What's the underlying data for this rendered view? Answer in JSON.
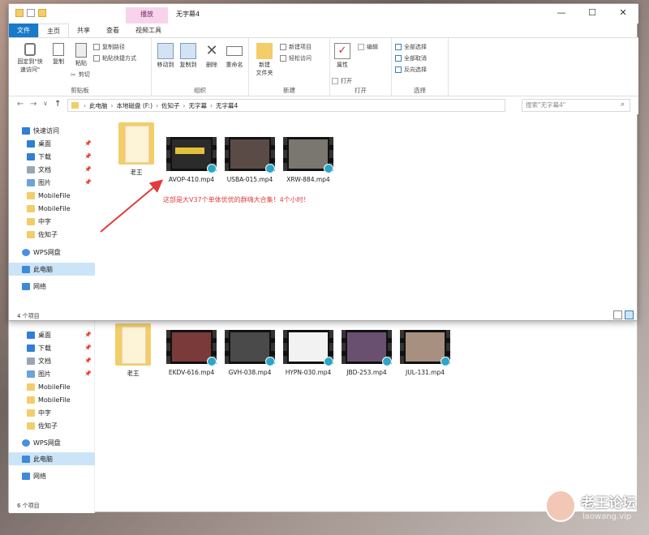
{
  "colors": {
    "accent": "#1979ca",
    "context_tab": "#f7d4ec",
    "annotation": "#e23b3b",
    "selection": "#cce4f7",
    "folder": "#f3cd6a",
    "play_badge": "#2aa6c8"
  },
  "window": {
    "title": "无字幕4",
    "context_tab": "播放",
    "controls": {
      "minimize": "—",
      "maximize": "☐",
      "close": "✕"
    }
  },
  "ribbon": {
    "tabs": [
      "文件",
      "主页",
      "共享",
      "查看",
      "视频工具"
    ],
    "clipboard": {
      "label": "剪贴板",
      "pin": "固定到\"快\n速访问\"",
      "copy": "复制",
      "paste": "粘贴",
      "copy_path": "复制路径",
      "paste_shortcut": "粘贴快捷方式",
      "cut": "剪切"
    },
    "organize": {
      "label": "组织",
      "move_to": "移动到",
      "copy_to": "复制到",
      "delete": "删除",
      "rename": "重命名"
    },
    "new": {
      "label": "新建",
      "new_folder": "新建\n文件夹",
      "new_item": "新建项目",
      "easy_access": "轻松访问"
    },
    "open": {
      "label": "打开",
      "properties": "属性",
      "open": "打开",
      "edit": "编辑"
    },
    "select": {
      "label": "选择",
      "select_all": "全部选择",
      "select_none": "全部取消",
      "invert": "反向选择"
    }
  },
  "address": {
    "crumbs": [
      "此电脑",
      "本地磁盘 (F:)",
      "佐知子",
      "无字幕",
      "无字幕4"
    ],
    "search_placeholder": "搜索\"无字幕4\"",
    "back": "←",
    "forward": "→",
    "dropdown": "∨",
    "up": "↑"
  },
  "nav": {
    "quick_access": "快速访问",
    "items": [
      "桌面",
      "下载",
      "文档",
      "图片",
      "MobileFile",
      "MobileFile",
      "中字",
      "佐知子"
    ],
    "wps": "WPS网盘",
    "this_pc": "此电脑",
    "network": "网络"
  },
  "content": {
    "items": [
      {
        "name": "老王",
        "type": "folder"
      },
      {
        "name": "AVOP-410.mp4",
        "type": "video",
        "tint": "#2b2b2b"
      },
      {
        "name": "USBA-015.mp4",
        "type": "video",
        "tint": "#5a4b46"
      },
      {
        "name": "XRW-884.mp4",
        "type": "video",
        "tint": "#7a7770"
      }
    ],
    "annotation": "这部是大V37个单体优优的群嗨大合集！4个小时！",
    "status": "4 个项目"
  },
  "back_window": {
    "items": [
      {
        "name": "老王",
        "type": "folder"
      },
      {
        "name": "EKDV-616.mp4",
        "type": "video",
        "tint": "#7a3a3a"
      },
      {
        "name": "GVH-038.mp4",
        "type": "video",
        "tint": "#4a4a4a"
      },
      {
        "name": "HYPN-030.mp4",
        "type": "video",
        "tint": "#f2f2f2"
      },
      {
        "name": "JBD-253.mp4",
        "type": "video",
        "tint": "#6a5070"
      },
      {
        "name": "JUL-131.mp4",
        "type": "video",
        "tint": "#a89080"
      }
    ],
    "status": "6 个项目"
  },
  "watermark": {
    "name": "老王论坛",
    "site": "laowang.vip"
  }
}
